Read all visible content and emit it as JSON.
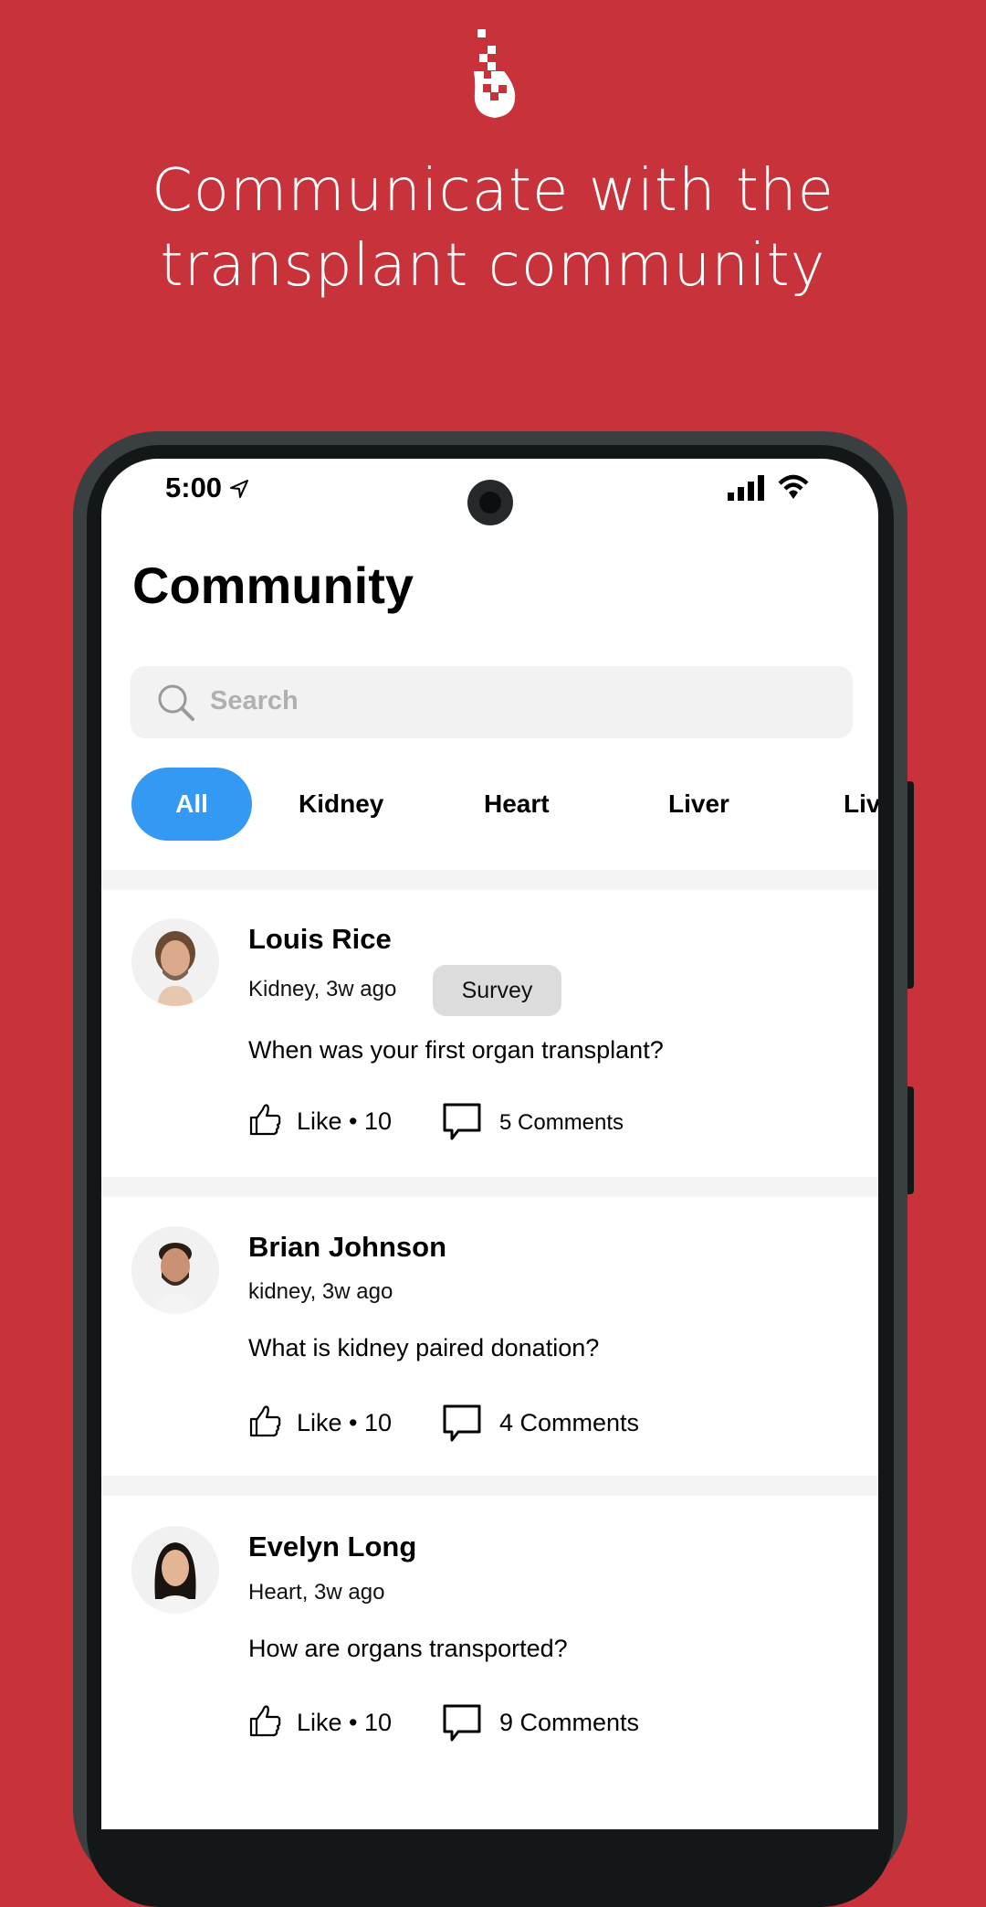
{
  "colors": {
    "background": "#C8323A",
    "accent": "#3399F3",
    "tag_bg": "#DCDCDC"
  },
  "logo": {
    "icon": "pixel-drop-logo"
  },
  "headline": {
    "line1": "Communicate with the",
    "line2": "transplant community"
  },
  "status_bar": {
    "time": "5:00",
    "icons": [
      "location-arrow-icon",
      "signal-icon",
      "wifi-icon"
    ]
  },
  "page": {
    "title": "Community"
  },
  "search": {
    "placeholder": "Search"
  },
  "filters": [
    {
      "label": "All",
      "active": true
    },
    {
      "label": "Kidney",
      "active": false
    },
    {
      "label": "Heart",
      "active": false
    },
    {
      "label": "Liver",
      "active": false
    },
    {
      "label": "Liv",
      "active": false
    }
  ],
  "posts": [
    {
      "author": "Louis Rice",
      "meta": "Kidney, 3w ago",
      "tag": "Survey",
      "question": "When was your first organ transplant?",
      "likes": "Like • 10",
      "comments": "5 Comments"
    },
    {
      "author": "Brian Johnson",
      "meta": "kidney, 3w ago",
      "question": "What is kidney paired donation?",
      "likes": "Like • 10",
      "comments": "4 Comments"
    },
    {
      "author": "Evelyn Long",
      "meta": "Heart, 3w ago",
      "question": "How are organs transported?",
      "likes": "Like • 10",
      "comments": "9 Comments"
    }
  ]
}
